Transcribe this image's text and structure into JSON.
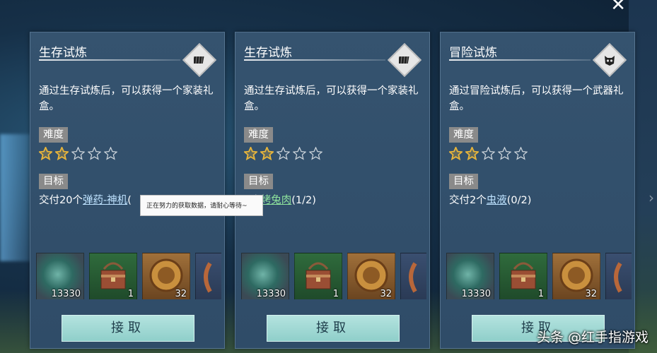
{
  "close_icon": "close-icon",
  "cards": [
    {
      "title": "生存试炼",
      "emblem_icon": "book-icon",
      "description": "通过生存试炼后，可以获得一个家装礼盒。",
      "difficulty_label": "难度",
      "difficulty_stars": 2,
      "difficulty_max": 5,
      "goal_label": "目标",
      "goal_prefix": "交付20个",
      "goal_item": "弹药-神机",
      "goal_suffix": "(",
      "rewards": [
        {
          "icon": "jade-ring-icon",
          "count": "13330"
        },
        {
          "icon": "treasure-chest-icon",
          "count": "1"
        },
        {
          "icon": "gold-coin-icon",
          "count": "32"
        },
        {
          "icon": "bronze-item-icon",
          "count": ""
        }
      ],
      "accept_label": "接取"
    },
    {
      "title": "生存试炼",
      "emblem_icon": "book-icon",
      "description": "通过生存试炼后，可以获得一个家装礼盒。",
      "difficulty_label": "难度",
      "difficulty_stars": 2,
      "difficulty_max": 5,
      "goal_label": "目标",
      "goal_prefix": "2个",
      "goal_item": "烤兔肉",
      "goal_suffix": "(1/2)",
      "rewards": [
        {
          "icon": "jade-ring-icon",
          "count": "13330"
        },
        {
          "icon": "treasure-chest-icon",
          "count": "1"
        },
        {
          "icon": "gold-coin-icon",
          "count": "32"
        },
        {
          "icon": "bronze-item-icon",
          "count": ""
        }
      ],
      "accept_label": "接取"
    },
    {
      "title": "冒险试炼",
      "emblem_icon": "mask-icon",
      "description": "通过冒险试炼后，可以获得一个武器礼盒。",
      "difficulty_label": "难度",
      "difficulty_stars": 2,
      "difficulty_max": 5,
      "goal_label": "目标",
      "goal_prefix": "交付2个",
      "goal_item": "虫液",
      "goal_suffix": "(0/2)",
      "rewards": [
        {
          "icon": "jade-ring-icon",
          "count": "13330"
        },
        {
          "icon": "treasure-chest-icon",
          "count": "1"
        },
        {
          "icon": "gold-coin-icon",
          "count": "32"
        },
        {
          "icon": "bronze-item-icon",
          "count": ""
        }
      ],
      "accept_label": "接取"
    }
  ],
  "tooltip": "正在努力的获取数据，请耐心等待~",
  "watermark": "头条 @红手指游戏",
  "colors": {
    "card_bg": "#35536f",
    "button_bg": "#9fd8d3",
    "tag_bg": "#8a8a8a",
    "star_gold": "#e8b53b",
    "goal_link": "#bfe3ff",
    "goal_link_green": "#8fe39d"
  }
}
